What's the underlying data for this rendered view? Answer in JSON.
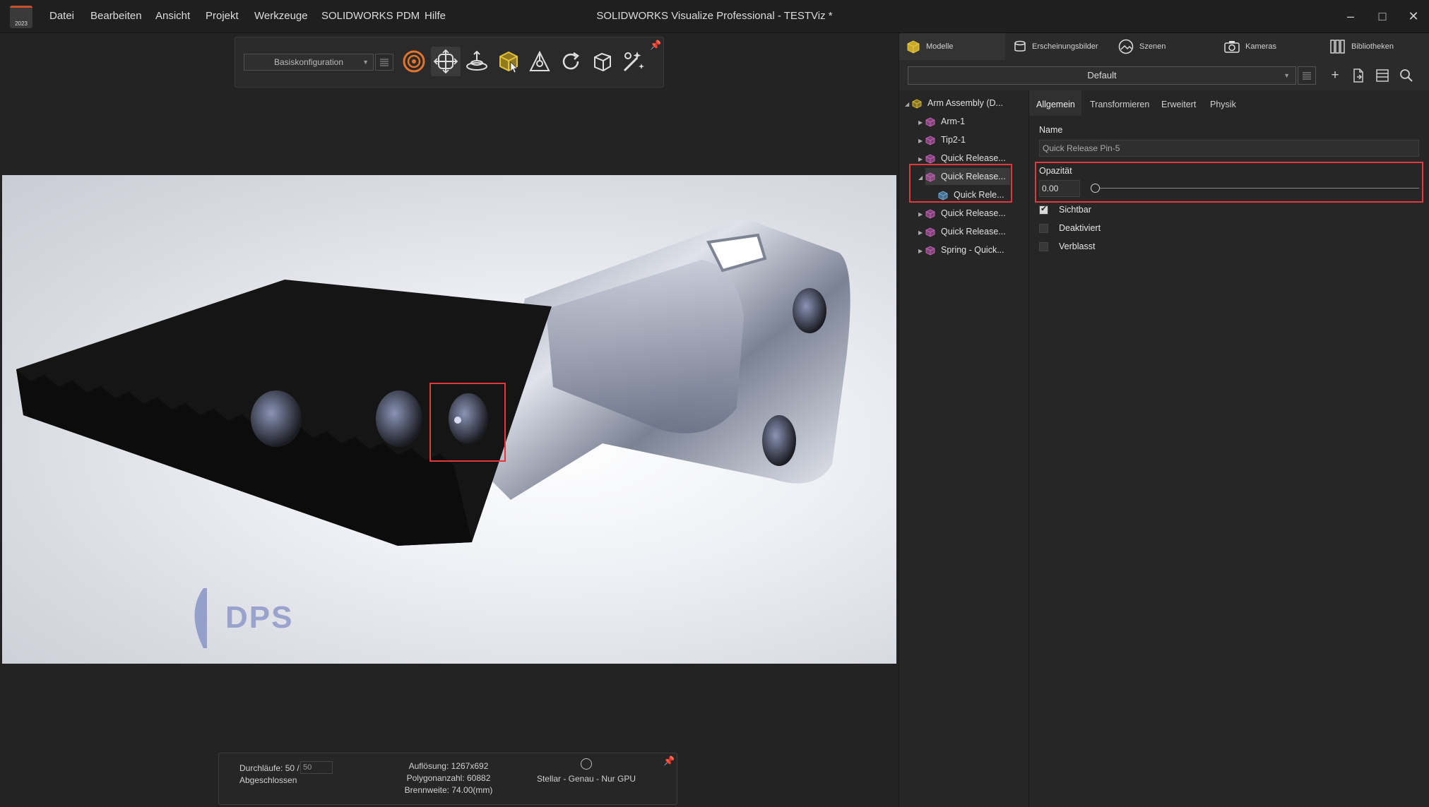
{
  "app": {
    "logo_text": "2023",
    "title": "SOLIDWORKS Visualize Professional - TESTViz *"
  },
  "menu": [
    "Datei",
    "Bearbeiten",
    "Ansicht",
    "Projekt",
    "Werkzeuge",
    "SOLIDWORKS PDM",
    "Hilfe"
  ],
  "toolbar": {
    "configuration": "Basiskonfiguration",
    "icons": [
      "target-icon",
      "transform-icon",
      "floor-icon",
      "select-part-icon",
      "origin-icon",
      "refresh-icon",
      "box-icon",
      "magic-wand-icon"
    ]
  },
  "render": {
    "watermark": "DPS"
  },
  "status": {
    "passes_label": "Durchläufe: 50 /",
    "passes_value": "50",
    "state": "Abgeschlossen",
    "resolution": "Auflösung: 1267x692",
    "polygons": "Polygonanzahl: 60882",
    "focal": "Brennweite: 74.00(mm)",
    "mode": "Stellar - Genau - Nur GPU"
  },
  "panel_tabs": [
    {
      "label": "Modelle",
      "icon": "model-cube-icon"
    },
    {
      "label": "Erscheinungsbilder",
      "icon": "appearance-icon"
    },
    {
      "label": "Szenen",
      "icon": "scene-icon"
    },
    {
      "label": "Kameras",
      "icon": "camera-icon"
    },
    {
      "label": "Bibliotheken",
      "icon": "library-icon"
    }
  ],
  "model_select": "Default",
  "tree": [
    {
      "label": "Arm Assembly (D...",
      "expanded": true,
      "level": 0,
      "color": "#d6b52c"
    },
    {
      "label": "Arm-1",
      "expanded": false,
      "level": 1,
      "color": "#c45fb8"
    },
    {
      "label": "Tip2-1",
      "expanded": false,
      "level": 1,
      "color": "#c45fb8"
    },
    {
      "label": "Quick Release...",
      "expanded": false,
      "level": 1,
      "color": "#c45fb8"
    },
    {
      "label": "Quick Release...",
      "expanded": true,
      "level": 1,
      "color": "#c45fb8",
      "selected": true
    },
    {
      "label": "Quick Rele...",
      "expanded": null,
      "level": 2,
      "color": "#6aa8d8"
    },
    {
      "label": "Quick Release...",
      "expanded": false,
      "level": 1,
      "color": "#c45fb8"
    },
    {
      "label": "Quick Release...",
      "expanded": false,
      "level": 1,
      "color": "#c45fb8"
    },
    {
      "label": "Spring - Quick...",
      "expanded": false,
      "level": 1,
      "color": "#c45fb8"
    }
  ],
  "props": {
    "tabs": [
      "Allgemein",
      "Transformieren",
      "Erweitert",
      "Physik"
    ],
    "name_label": "Name",
    "name_value": "Quick Release Pin-5",
    "opacity_label": "Opazität",
    "opacity_value": "0.00",
    "opacity_level": 0.0,
    "checks": [
      {
        "label": "Sichtbar",
        "checked": true
      },
      {
        "label": "Deaktiviert",
        "checked": false
      },
      {
        "label": "Verblasst",
        "checked": false
      }
    ]
  },
  "colors": {
    "accent_red": "#e0383c",
    "toolbar_orange": "#e3742b",
    "selection": "#3a3a3a"
  }
}
